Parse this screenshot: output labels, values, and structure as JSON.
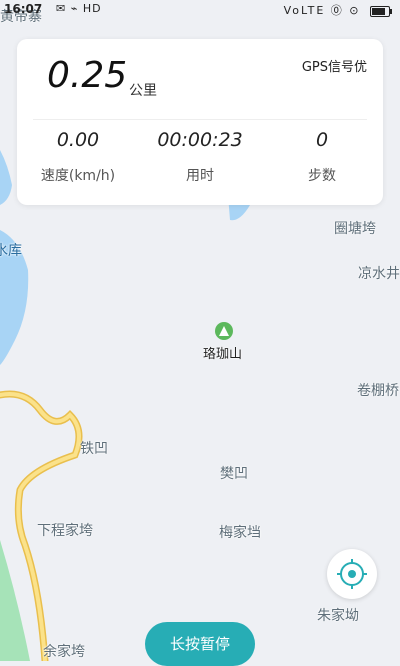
{
  "status_bar": {
    "time": "16:07",
    "left_icons": "✉ ⌁ HD",
    "right_icons": "VoLTE ⓪ ⊙"
  },
  "map": {
    "labels": [
      {
        "name": "top-left-label",
        "text": "黄帝寨"
      },
      {
        "name": "reservoir",
        "text": "水库"
      },
      {
        "name": "quan-tang-wan",
        "text": "圈塘垮"
      },
      {
        "name": "liang-shui-jing",
        "text": "凉水井"
      },
      {
        "name": "luo-jia-shan",
        "text": "珞珈山"
      },
      {
        "name": "juan-peng-qiao",
        "text": "卷棚桥"
      },
      {
        "name": "tie-ao",
        "text": "铁凹"
      },
      {
        "name": "fan-ao",
        "text": "樊凹"
      },
      {
        "name": "xia-cheng-jia-wan",
        "text": "下程家垮"
      },
      {
        "name": "mei-jia-dang",
        "text": "梅家垱"
      },
      {
        "name": "zhu-jia-ao",
        "text": "朱家坳"
      },
      {
        "name": "yu-jia-wan",
        "text": "余家垮"
      }
    ],
    "colors": {
      "water": "#a8d4f5",
      "road_fill": "#fbe28a",
      "road_edge": "#e9bf4d",
      "green": "#a6e3b8",
      "poi": "#5cb85c"
    }
  },
  "card": {
    "distance": "0.25",
    "distance_unit": "公里",
    "gps_status": "GPS信号优",
    "stats": [
      {
        "value": "0.00",
        "label": "速度(km/h)"
      },
      {
        "value": "00:00:23",
        "label": "用时"
      },
      {
        "value": "0",
        "label": "步数"
      }
    ]
  },
  "controls": {
    "locate_icon": "crosshair-icon",
    "pause_label": "长按暂停",
    "accent": "#27adb5"
  }
}
